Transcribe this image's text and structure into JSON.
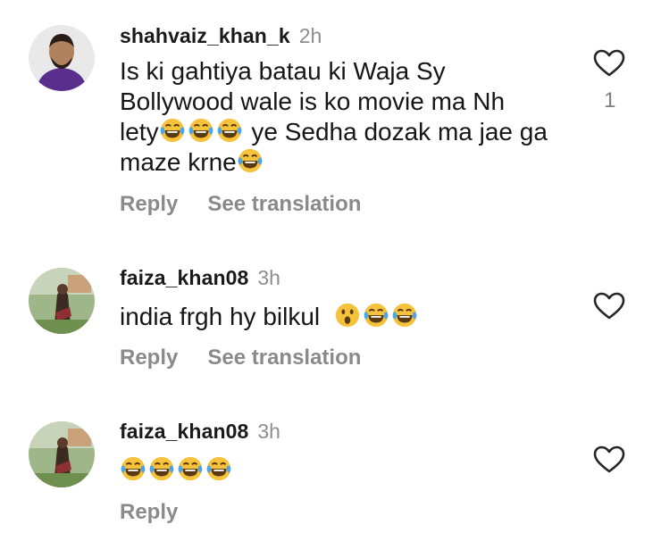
{
  "comments": [
    {
      "username": "shahvaiz_khan_k",
      "time": "2h",
      "text_lines": [
        "Is ki gahtiya batau ki Waja Sy",
        "Bollywood wale is ko movie ma Nh",
        "lety",
        " ye Sedha dozak ma jae ga",
        "maze krne"
      ],
      "reply_label": "Reply",
      "translation_label": "See translation",
      "like_count": "1",
      "heart_icon": "heart-outline-icon",
      "emoji_icon": "laughing-tears-emoji"
    },
    {
      "username": "faiza_khan08",
      "time": "3h",
      "text": "india frgh hy bilkul",
      "reply_label": "Reply",
      "translation_label": "See translation",
      "heart_icon": "heart-outline-icon",
      "emoji_icons": [
        "surprised-face-emoji",
        "laughing-tears-emoji",
        "laughing-tears-emoji"
      ]
    },
    {
      "username": "faiza_khan08",
      "time": "3h",
      "reply_label": "Reply",
      "heart_icon": "heart-outline-icon",
      "emoji_icons": [
        "laughing-tears-emoji",
        "laughing-tears-emoji",
        "laughing-tears-emoji",
        "laughing-tears-emoji"
      ]
    }
  ],
  "colors": {
    "secondary_text": "#8e8e8e",
    "primary_text": "#161616",
    "emoji_yellow": "#f7c23b"
  }
}
